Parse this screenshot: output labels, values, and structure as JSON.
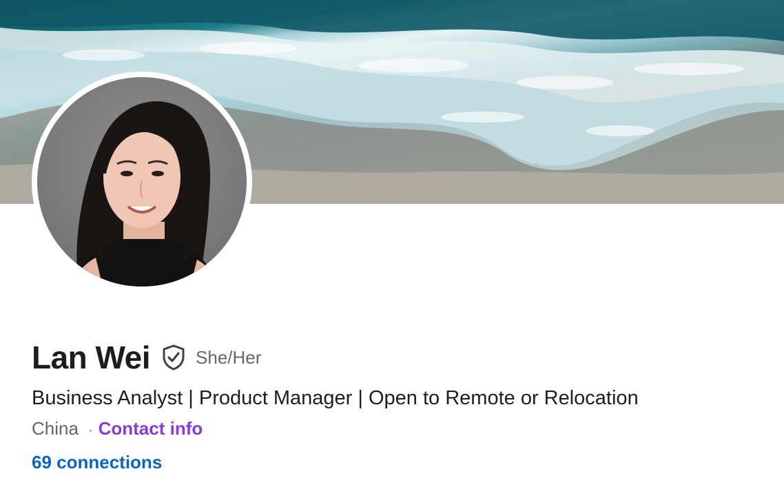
{
  "banner": {
    "description_icon": "ocean-shore-banner-image"
  },
  "profile": {
    "avatar_icon": "profile-photo",
    "name": "Lan Wei",
    "verified_icon": "verified-shield-icon",
    "pronouns": "She/Her",
    "headline": "Business Analyst | Product Manager | Open to Remote or Relocation",
    "location": "China",
    "separator": "·",
    "contact_info_label": "Contact info",
    "connections_label": "69 connections"
  },
  "colors": {
    "link_purple": "#8a3ad6",
    "link_blue": "#0a66c2",
    "text_primary": "#1d1d1d",
    "text_secondary": "#666666"
  }
}
